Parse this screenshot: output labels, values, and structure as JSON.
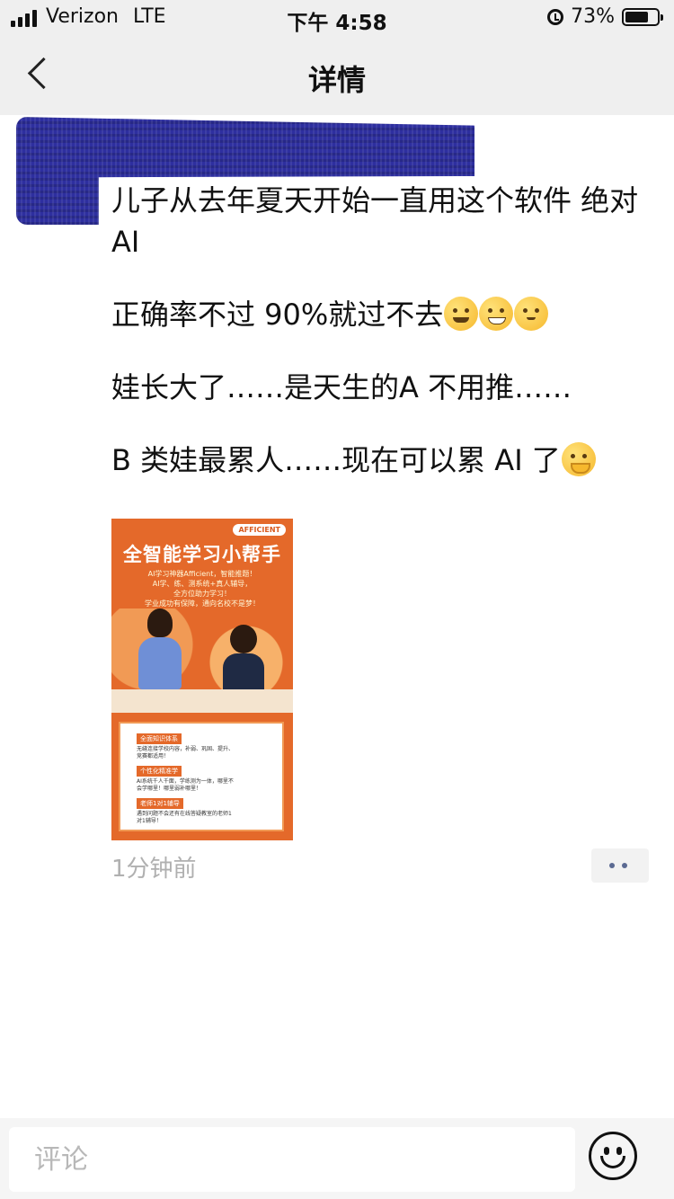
{
  "status_bar": {
    "carrier": "Verizon",
    "network": "LTE",
    "time": "下午 4:58",
    "battery_percent": "73%",
    "battery_level": 0.73
  },
  "nav": {
    "title": "详情",
    "back_icon": "chevron-left-icon"
  },
  "post": {
    "paragraphs": [
      "儿子从去年夏天开始一直用这个软件 绝对AI",
      "正确率不过 90%就过不去",
      "娃长大了……是天生的A 不用推……",
      "B 类娃最累人……现在可以累 AI 了"
    ],
    "emojis": [
      "zipper-mouth-emoji",
      "grimacing-emoji",
      "blushing-emoji",
      "hand-over-mouth-emoji"
    ],
    "time": "1分钟前",
    "more_icon": "more-dots-icon",
    "image": {
      "brand": "AFFICIENT",
      "title": "全智能学习小帮手",
      "lines": [
        "AI学习神器Afficient，智能推题！",
        "AI学、练、测系统+真人辅导，",
        "全方位助力学习！",
        "学业成功有保障，通向名校不是梦！"
      ],
      "features": [
        {
          "tag": "全面知识体系",
          "text": "无缝连接学校内容，补弱、巩固、提升、竞赛都适用！"
        },
        {
          "tag": "个性化精准学",
          "text": "AI系统千人千面，学练测为一体，哪里不会学哪里！哪里弱补哪里！"
        },
        {
          "tag": "老师1对1辅导",
          "text": "遇到问题不会还有在线答疑教室的老师1对1辅导！"
        }
      ]
    }
  },
  "comment": {
    "placeholder": "评论",
    "emoji_icon": "smiley-icon"
  },
  "colors": {
    "bar_bg": "#efefef",
    "poster_orange": "#e4692a",
    "redaction": "#2e2f9f",
    "meta_gray": "#b0b0b0",
    "dots": "#5b6a92"
  }
}
